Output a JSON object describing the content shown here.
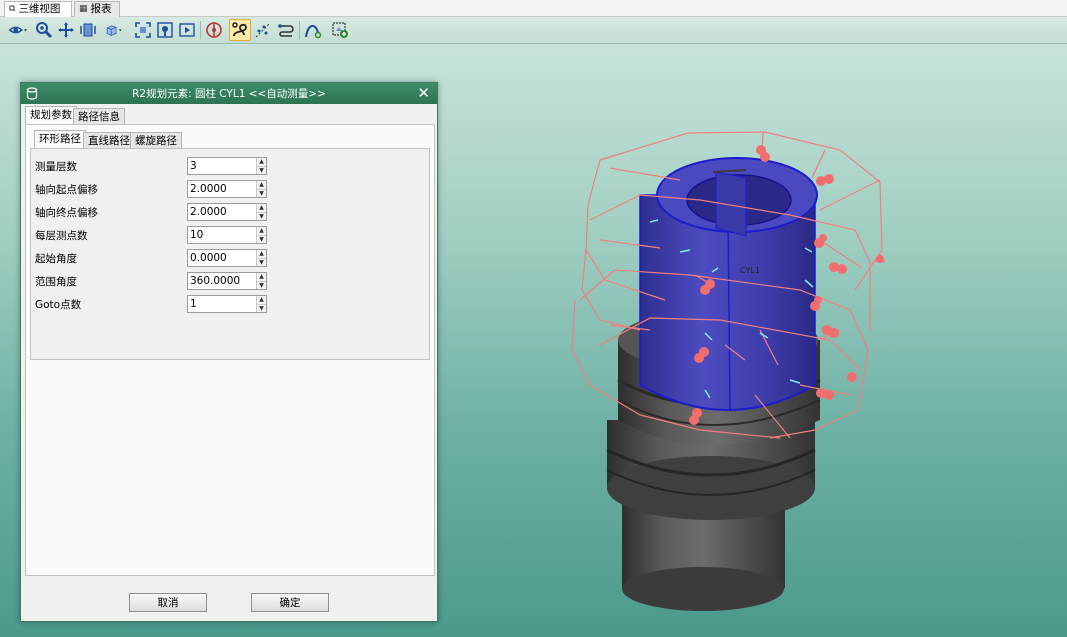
{
  "doc_tabs": [
    {
      "label": "三维视图",
      "icon": "3d-view-icon",
      "active": true
    },
    {
      "label": "报表",
      "icon": "report-icon",
      "active": false
    }
  ],
  "toolbar": {
    "items": [
      "view-eye-icon",
      "zoom-icon",
      "pan-icon",
      "rotate-view-icon",
      "cube-view-icon",
      "fit-all-icon",
      "locate-icon",
      "play-view-icon",
      "probe-icon",
      "auto-path-icon",
      "scatter-icon",
      "path-edit-icon",
      "curve-icon",
      "add-frame-icon"
    ],
    "active_item": "auto-path-icon"
  },
  "dialog": {
    "title": "R2规划元素: 圆柱 CYL1 <<自动测量>>",
    "close_label": "✕",
    "main_tabs": [
      {
        "label": "规划参数",
        "active": true
      },
      {
        "label": "路径信息",
        "active": false
      }
    ],
    "sub_tabs": [
      {
        "label": "环形路径",
        "active": true
      },
      {
        "label": "直线路径",
        "active": false
      },
      {
        "label": "螺旋路径",
        "active": false
      }
    ],
    "params": [
      {
        "label": "测量层数",
        "value": "3"
      },
      {
        "label": "轴向起点偏移",
        "value": "2.0000"
      },
      {
        "label": "轴向终点偏移",
        "value": "2.0000"
      },
      {
        "label": "每层测点数",
        "value": "10"
      },
      {
        "label": "起始角度",
        "value": "0.0000"
      },
      {
        "label": "范围角度",
        "value": "360.0000"
      },
      {
        "label": "Goto点数",
        "value": "1"
      }
    ],
    "cancel_label": "取消",
    "ok_label": "确定"
  },
  "viewport": {
    "feature_label": "CYL1",
    "colors": {
      "cylinder": "#3b3aa5",
      "path": "#f08080",
      "point": "#f26d6d",
      "part": "#4a4a4a",
      "vector": "#7fe8f0"
    }
  }
}
